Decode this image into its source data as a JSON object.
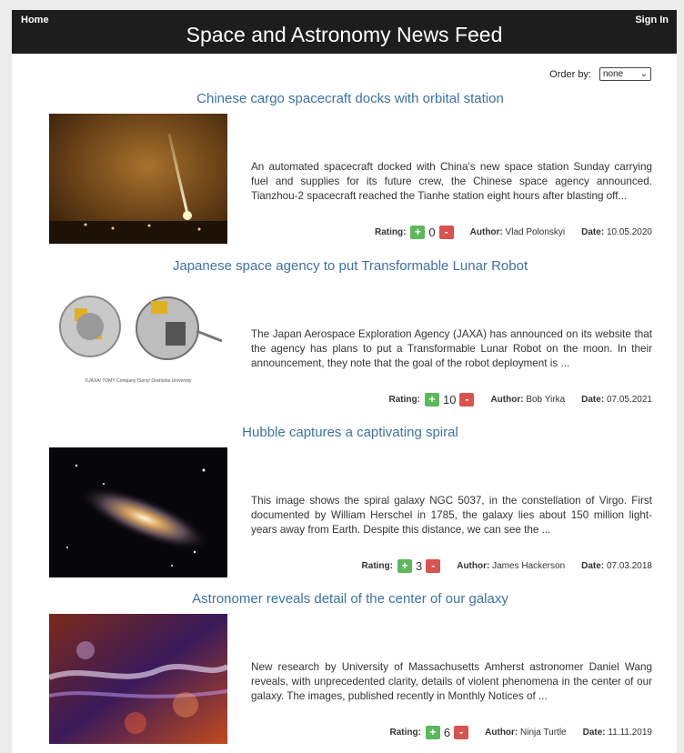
{
  "nav": {
    "home": "Home",
    "signin": "Sign In",
    "title": "Space and Astronomy News Feed"
  },
  "order": {
    "label": "Order by:",
    "selected": "none"
  },
  "meta_labels": {
    "rating": "Rating:",
    "author": "Author:",
    "date": "Date:",
    "plus": "+",
    "minus": "-"
  },
  "articles": [
    {
      "title": "Chinese cargo spacecraft docks with orbital station",
      "text": "An automated spacecraft docked with China's new space station Sunday carrying fuel and supplies for its future crew, the Chinese space agency announced. Tianzhou-2 spacecraft reached the Tianhe station eight hours after blasting off...",
      "rating": "0",
      "author": "Vlad Polonskyi",
      "date": "10.05.2020"
    },
    {
      "title": "Japanese space agency to put Transformable Lunar Robot",
      "text": "The Japan Aerospace Exploration Agency (JAXA) has announced on its website that the agency has plans to put a Transformable Lunar Robot on the moon. In their announcement, they note that the goal of the robot deployment is ...",
      "rating": "10",
      "author": "Bob Yirka",
      "date": "07.05.2021",
      "caption": "©JAXA/ TOMY Company /Sony/ Doshisha University"
    },
    {
      "title": "Hubble captures a captivating spiral",
      "text": "This image shows the spiral galaxy NGC 5037, in the constellation of Virgo. First documented by William Herschel in 1785, the galaxy lies about 150 million light-years away from Earth. Despite this distance, we can see the ...",
      "rating": "3",
      "author": "James Hackerson",
      "date": "07.03.2018"
    },
    {
      "title": "Astronomer reveals detail of the center of our galaxy",
      "text": "New research by University of Massachusetts Amherst astronomer Daniel Wang reveals, with unprecedented clarity, details of violent phenomena in the center of our galaxy. The images, published recently in Monthly Notices of ...",
      "rating": "6",
      "author": "Ninja Turtle",
      "date": "11.11.2019"
    }
  ]
}
